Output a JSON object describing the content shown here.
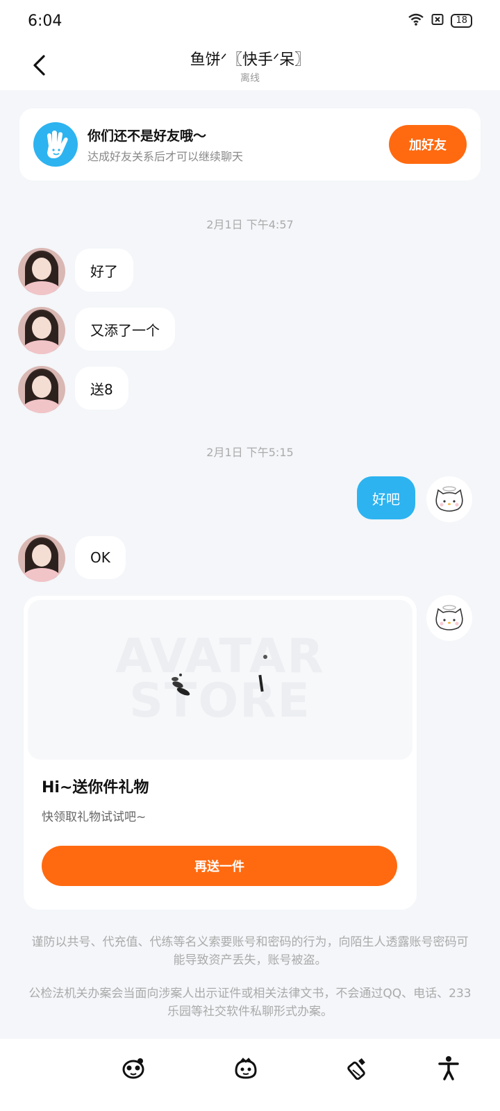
{
  "status_bar": {
    "time": "6:04",
    "battery": "18",
    "icons": [
      "wifi-icon",
      "sim-card-icon",
      "battery-icon"
    ]
  },
  "header": {
    "title": "鱼饼ᐟ〖快手ᐟ呆〗",
    "subtitle": "离线"
  },
  "friend_banner": {
    "title": "你们还不是好友哦～",
    "description": "达成好友关系后才可以继续聊天",
    "add_button": "加好友"
  },
  "messages": {
    "timestamp_1": "2月1日 下午4:57",
    "msg_1": "好了",
    "msg_2": "又添了一个",
    "msg_3": "送8",
    "timestamp_2": "2月1日 下午5:15",
    "msg_4": "好吧",
    "msg_5": "OK"
  },
  "gift_card": {
    "watermark_line1": "AVATAR",
    "watermark_line2": "STORE",
    "title": "Hi~送你件礼物",
    "description": "快领取礼物试试吧~",
    "button": "再送一件"
  },
  "notices": {
    "notice_1": "谨防以共号、代充值、代练等名义索要账号和密码的行为，向陌生人透露账号密码可能导致资产丢失，账号被盗。",
    "notice_2": "公检法机关办案会当面向涉案人出示证件或相关法律文书，不会通过QQ、电话、233乐园等社交软件私聊形式办案。"
  },
  "colors": {
    "accent_orange": "#ff6a10",
    "bubble_blue": "#2db3f0",
    "background": "#f4f6f9"
  }
}
